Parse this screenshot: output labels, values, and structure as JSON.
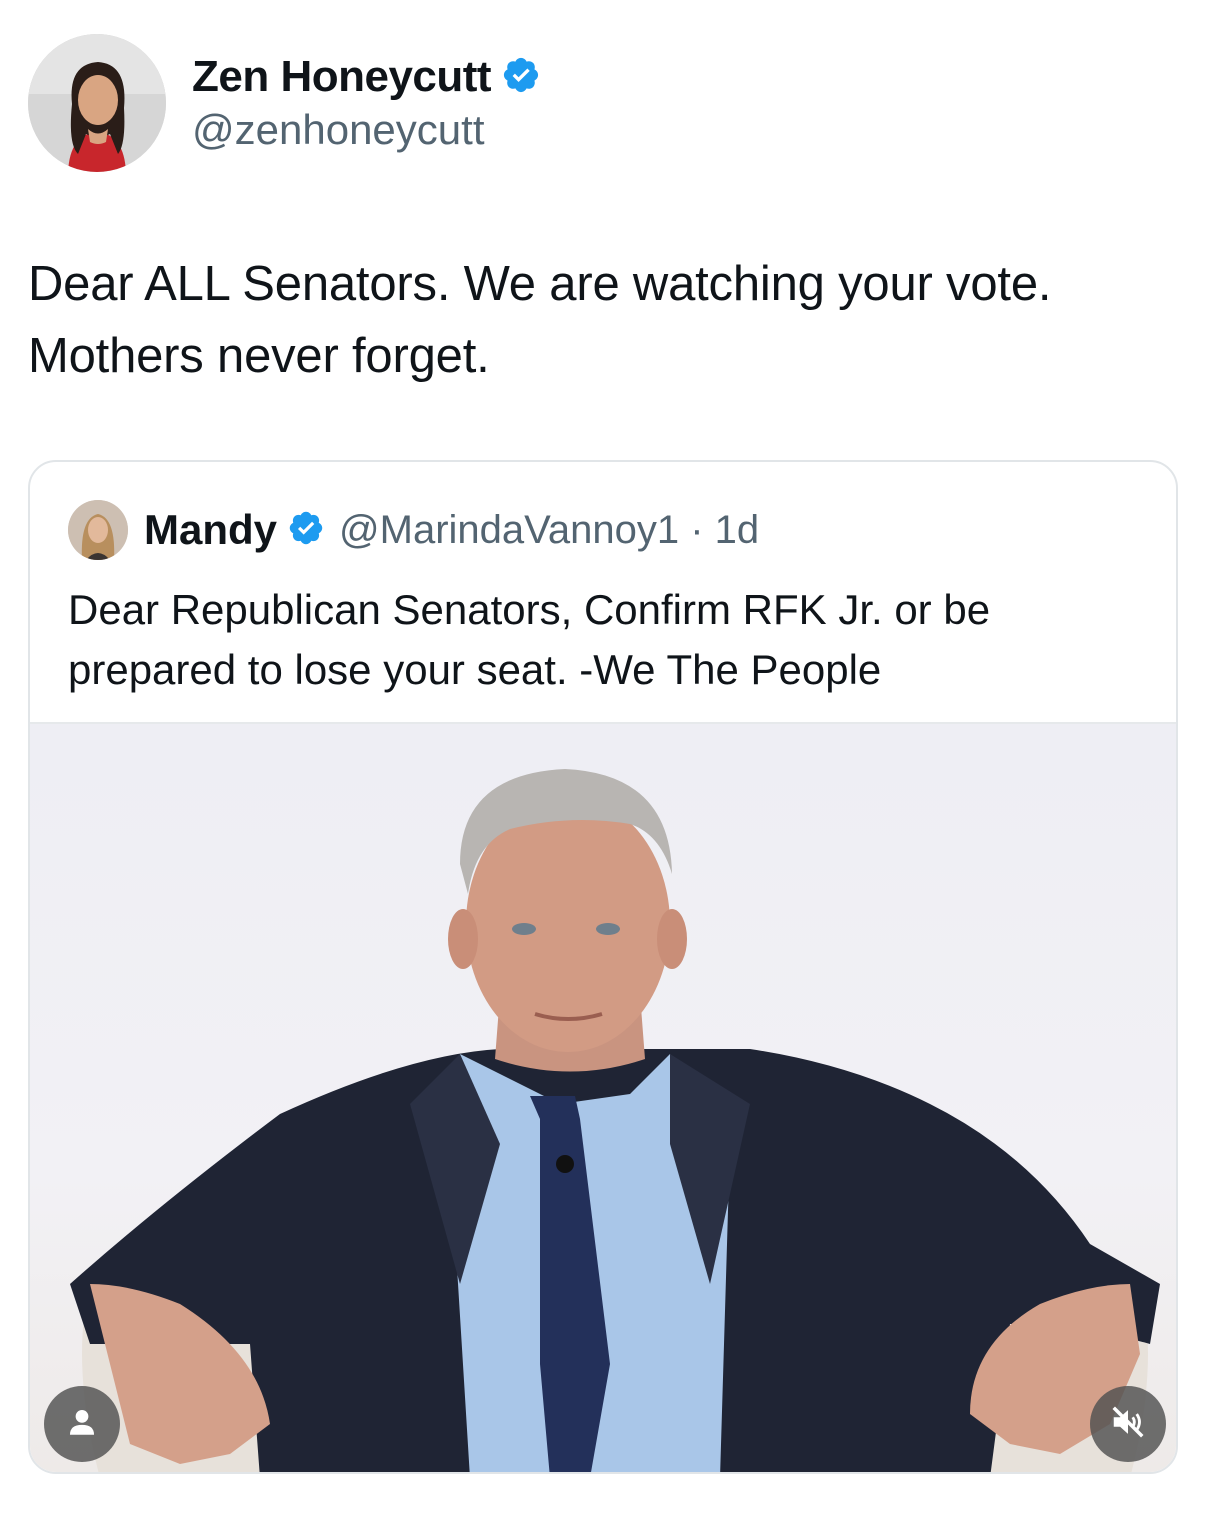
{
  "author": {
    "name": "Zen Honeycutt",
    "handle": "@zenhoneycutt",
    "verified": true
  },
  "tweet": {
    "lines": [
      "Dear ALL Senators. We are watching your vote.",
      "Mothers never forget."
    ]
  },
  "quoted": {
    "name": "Mandy",
    "handle_and_time": "@MarindaVannoy1 · 1d",
    "verified": true,
    "lines": [
      "Dear Republican Senators, Confirm RFK Jr. or be",
      "prepared to lose your seat. -We The People"
    ]
  },
  "media": {
    "buttons": {
      "left_icon": "person-tag-icon",
      "right_icon": "muted-speaker-icon"
    }
  },
  "colors": {
    "verified_blue": "#1d9bf0",
    "handle_gray": "#536471",
    "text": "#0f1419"
  }
}
